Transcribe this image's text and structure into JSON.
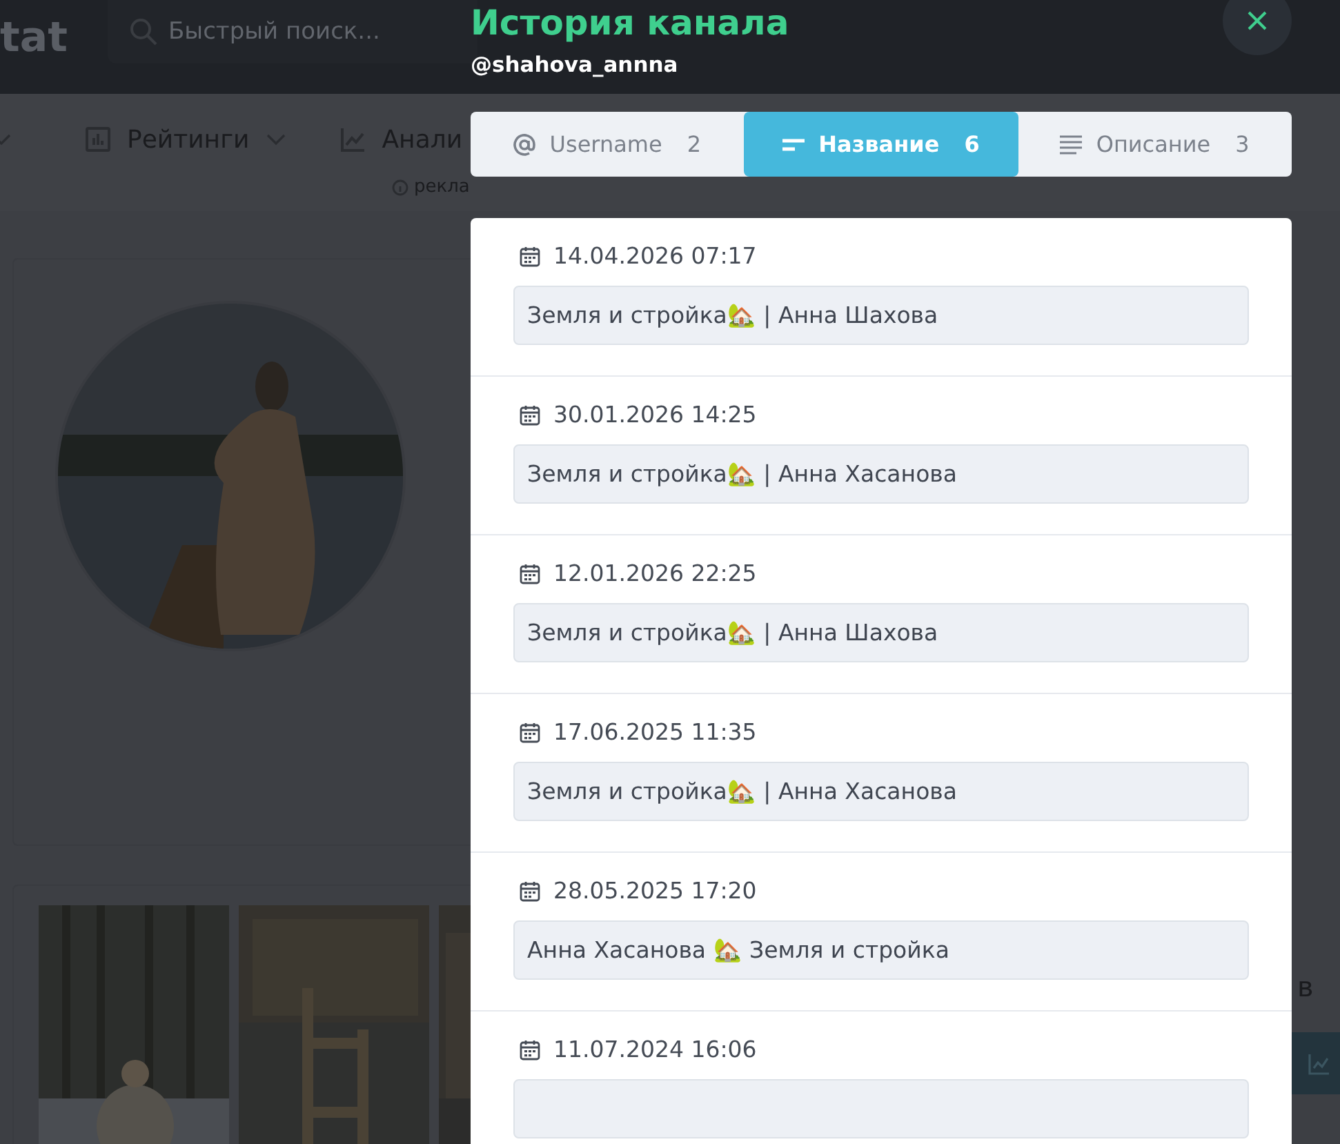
{
  "page": {
    "logo": "tat",
    "search": {
      "placeholder": "Быстрый поиск..."
    },
    "nav": [
      {
        "label": "Рейтинги",
        "kind": "bars",
        "dropdown": true
      },
      {
        "label": "Анали",
        "kind": "line",
        "dropdown": false
      }
    ],
    "note": "рекла",
    "side_text": "в"
  },
  "modal": {
    "title": "История канала",
    "handle": "@shahova_annna",
    "tabs": [
      {
        "label": "Username",
        "count": "2",
        "kind": "at",
        "selected": false
      },
      {
        "label": "Название",
        "count": "6",
        "kind": "short",
        "selected": true
      },
      {
        "label": "Описание",
        "count": "3",
        "kind": "lines",
        "selected": false
      }
    ],
    "entries": [
      {
        "date": "14.04.2026 07:17",
        "value": "Земля и стройка🏡 | Анна Шахова"
      },
      {
        "date": "30.01.2026 14:25",
        "value": "Земля и стройка🏡 | Анна Хасанова"
      },
      {
        "date": "12.01.2026 22:25",
        "value": "Земля и стройка🏡 | Анна Шахова"
      },
      {
        "date": "17.06.2025 11:35",
        "value": "Земля и стройка🏡 | Анна Хасанова"
      },
      {
        "date": "28.05.2025 17:20",
        "value": "Анна Хасанова 🏡 Земля и стройка"
      },
      {
        "date": "11.07.2024 16:06"
      }
    ]
  }
}
